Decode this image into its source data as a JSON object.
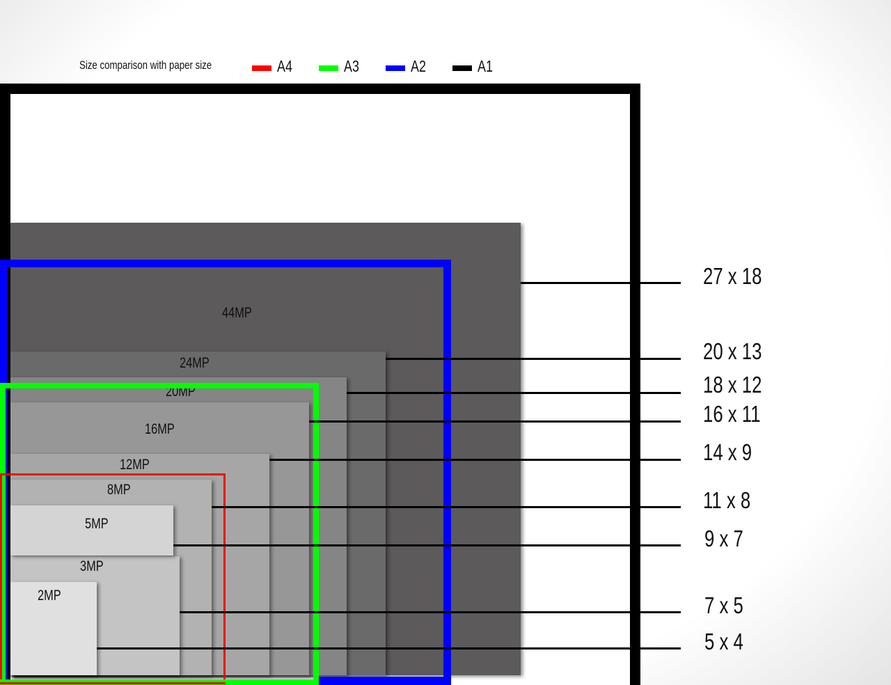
{
  "legend": {
    "title": "Size comparison with paper size",
    "items": [
      {
        "label": "A4",
        "color": "#ff0000"
      },
      {
        "label": "A3",
        "color": "#00ff00"
      },
      {
        "label": "A2",
        "color": "#0000ff"
      },
      {
        "label": "A1",
        "color": "#000000"
      }
    ]
  },
  "megapixels": [
    {
      "label": "44MP",
      "color": "#5c5a5a"
    },
    {
      "label": "24MP",
      "color": "#6a6a6a"
    },
    {
      "label": "20MP",
      "color": "#858585"
    },
    {
      "label": "16MP",
      "color": "#979797"
    },
    {
      "label": "12MP",
      "color": "#a6a6a6"
    },
    {
      "label": "8MP",
      "color": "#b2b2b2"
    },
    {
      "label": "3MP",
      "color": "#c4c4c4"
    },
    {
      "label": "5MP",
      "color": "#d4d4d4"
    },
    {
      "label": "2MP",
      "color": "#e0e0e0"
    }
  ],
  "print_sizes": [
    "27 x 18",
    "20 x 13",
    "18 x 12",
    "16 x 11",
    "14 x 9",
    "11 x 8",
    "9 x 7",
    "7 x 5",
    "5 x 4"
  ]
}
